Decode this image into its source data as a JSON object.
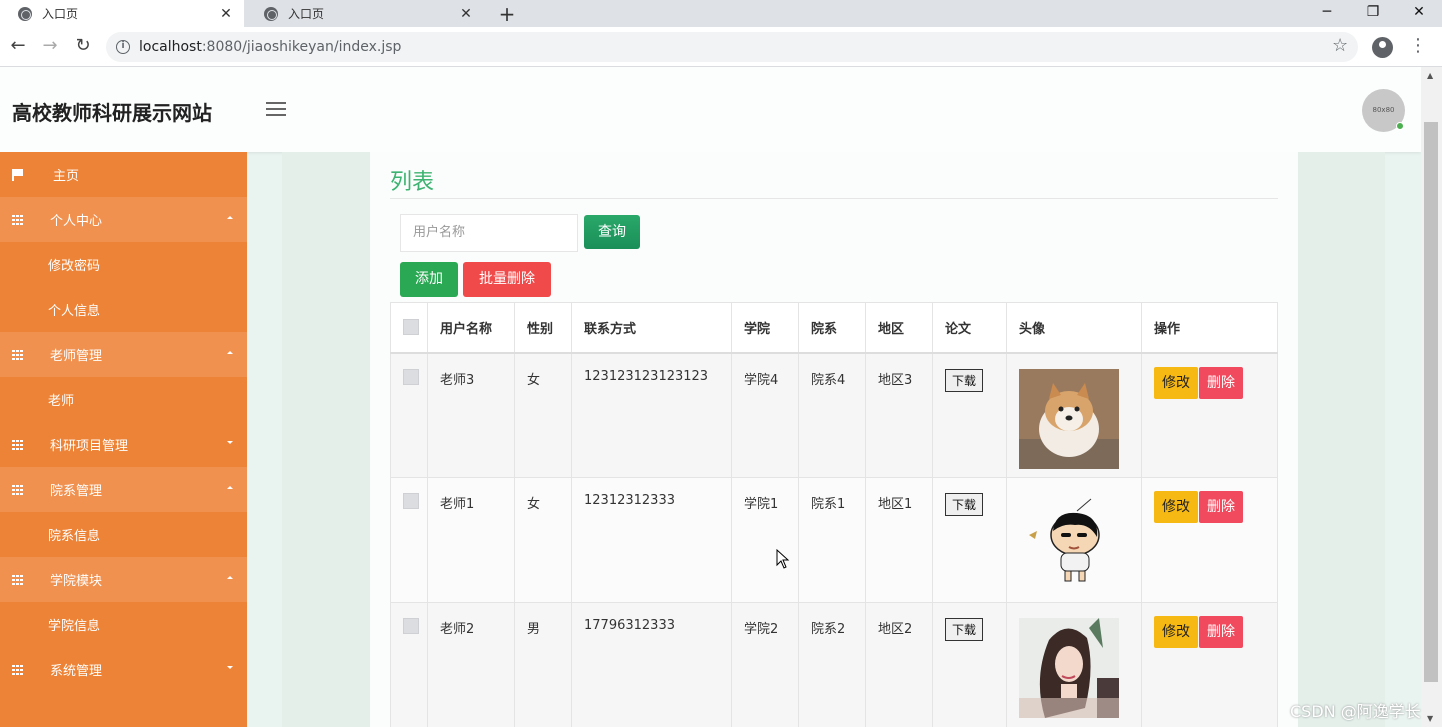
{
  "browser": {
    "tabs": [
      {
        "title": "入口页",
        "active": true
      },
      {
        "title": "入口页",
        "active": false
      }
    ],
    "new_tab": "+",
    "window_controls": {
      "minimize": "─",
      "restore": "❐",
      "close": "✕"
    },
    "url_host": "localhost",
    "url_path": ":8080/jiaoshikeyan/index.jsp"
  },
  "header": {
    "site_title": "高校教师科研展示网站",
    "avatar_text": "80x80"
  },
  "sidebar": {
    "home": "主页",
    "personal_center": "个人中心",
    "change_password": "修改密码",
    "personal_info": "个人信息",
    "teacher_mgmt": "老师管理",
    "teacher": "老师",
    "research_mgmt": "科研项目管理",
    "dept_mgmt": "院系管理",
    "dept_info": "院系信息",
    "college_module": "学院模块",
    "college_info": "学院信息",
    "system_mgmt": "系统管理"
  },
  "panel": {
    "title": "列表",
    "search_placeholder": "用户名称",
    "query_button": "查询",
    "add_button": "添加",
    "batch_delete_button": "批量删除"
  },
  "table": {
    "headers": [
      "用户名称",
      "性别",
      "联系方式",
      "学院",
      "院系",
      "地区",
      "论文",
      "头像",
      "操作"
    ],
    "download_label": "下载",
    "edit_label": "修改",
    "delete_label": "删除",
    "rows": [
      {
        "name": "老师3",
        "gender": "女",
        "phone": "123123123123123",
        "college": "学院4",
        "dept": "院系4",
        "region": "地区3",
        "avatar": "dog-photo"
      },
      {
        "name": "老师1",
        "gender": "女",
        "phone": "12312312333",
        "college": "学院1",
        "dept": "院系1",
        "region": "地区1",
        "avatar": "cartoon-boy"
      },
      {
        "name": "老师2",
        "gender": "男",
        "phone": "17796312333",
        "college": "学院2",
        "dept": "院系2",
        "region": "地区2",
        "avatar": "girl-illustration"
      }
    ]
  },
  "colors": {
    "sidebar": "#ed8336",
    "title_green": "#3cb371",
    "add_green": "#2aa853",
    "delete_red": "#f14a4a",
    "edit_yellow": "#f6b813"
  },
  "watermark": "CSDN @阿逸学长"
}
